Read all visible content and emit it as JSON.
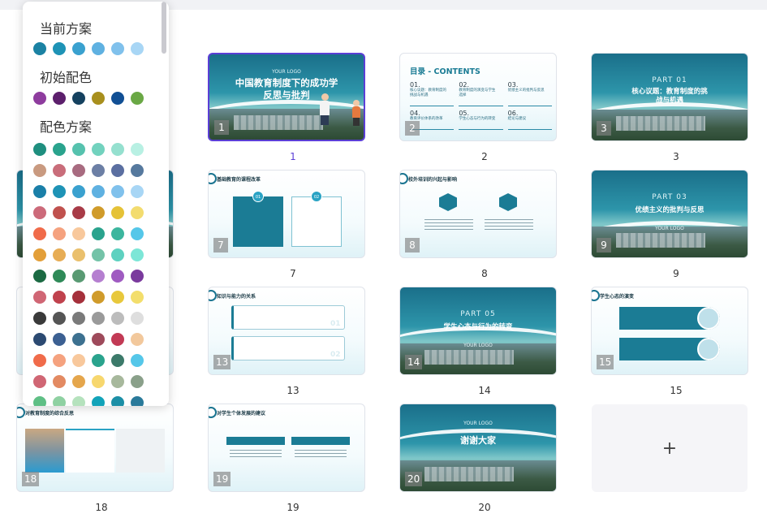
{
  "palette": {
    "current_label": "当前方案",
    "initial_label": "初始配色",
    "schemes_label": "配色方案",
    "current": [
      "#1b82a3",
      "#1e93b6",
      "#3aa1cf",
      "#5fb1e1",
      "#80c1ec",
      "#a8d6f5"
    ],
    "initial": [
      "#8e3c9e",
      "#5c1f6c",
      "#15415f",
      "#a88f1d",
      "#114f94",
      "#6aa845"
    ],
    "schemes": [
      [
        "#1f8f7f",
        "#2aa38d",
        "#56c2ae",
        "#72d2be",
        "#95e0cf",
        "#b8f0e3"
      ],
      [
        "#c99a80",
        "#c96d7a",
        "#a86b80",
        "#6c7fa5",
        "#5b6fa1",
        "#56799e"
      ],
      [
        "#1a7fa8",
        "#1e93b6",
        "#3aa1cf",
        "#5fb1e1",
        "#80c1ec",
        "#a8d6f5"
      ],
      [
        "#cc6a7a",
        "#c0514e",
        "#a83b47",
        "#d09b2a",
        "#e5c237",
        "#f3dc6f"
      ],
      [
        "#f06b4a",
        "#f5a27f",
        "#f8c89c",
        "#2aa38d",
        "#3cb69e",
        "#55c7e9"
      ],
      [
        "#e39f39",
        "#e7ad55",
        "#eac06d",
        "#74c3a8",
        "#5ed1c0",
        "#7de6d7"
      ],
      [
        "#1c6a43",
        "#2f8a58",
        "#599a73",
        "#b57fd0",
        "#9f5bc1",
        "#7a3a9d"
      ],
      [
        "#d06674",
        "#c0424d",
        "#a5303b",
        "#d09b2a",
        "#e8c83c",
        "#f3de6c"
      ],
      [
        "#3a3a3a",
        "#555555",
        "#7a7a7a",
        "#9a9a9a",
        "#bcbcbc",
        "#dedede"
      ],
      [
        "#2c4a72",
        "#3c6092",
        "#3d7190",
        "#9e4a5b",
        "#c23a55",
        "#f2c89c"
      ],
      [
        "#f06b4a",
        "#f5a27f",
        "#f8c89c",
        "#2aa38d",
        "#3c7a6a",
        "#55c7e9"
      ],
      [
        "#d06674",
        "#e38a62",
        "#e5a64c",
        "#f7d76e",
        "#a7b89c",
        "#8aa08a"
      ],
      [
        "#5fbf85",
        "#8fd1a2",
        "#b5e2bd",
        "#12a3b9",
        "#1c8fa6",
        "#2a7a9a"
      ]
    ]
  },
  "slides": [
    {
      "n": "1",
      "logo": "YOUR LOGO",
      "title": "中国教育制度下的成功学\n反思与批判"
    },
    {
      "n": "2",
      "title": "目录 - CONTENTS",
      "items": [
        {
          "no": "01.",
          "text": "核心议题：教育制度的\n挑战与机遇"
        },
        {
          "no": "02.",
          "text": "教育制度的演变与学生\n选择"
        },
        {
          "no": "03.",
          "text": "优绩主义的批判与反思"
        },
        {
          "no": "04.",
          "text": "教育评价体系的改革"
        },
        {
          "no": "05.",
          "text": "学生心态与行为的转变"
        },
        {
          "no": "06.",
          "text": "结论与建议"
        }
      ]
    },
    {
      "n": "3",
      "part": "PART 01",
      "title": "核心议题：教育制度的挑\n战与机遇"
    },
    {
      "n": "7",
      "title": "基础教育的课程改革",
      "b1": "01",
      "b2": "02"
    },
    {
      "n": "8",
      "title": "校外培训的兴起与影响"
    },
    {
      "n": "9",
      "part": "PART 03",
      "title": "优绩主义的批判与反思",
      "logo": "YOUR LOGO"
    },
    {
      "n": "13",
      "title": "知识与能力的关系",
      "b1": "01",
      "b2": "02"
    },
    {
      "n": "14",
      "part": "PART 05",
      "title": "学生心态与行为的转变",
      "logo": "YOUR LOGO"
    },
    {
      "n": "15",
      "title": "学生心态的演变"
    },
    {
      "n": "18",
      "title": "对教育制度的综合反思"
    },
    {
      "n": "19",
      "title": "对学生个体发展的建议"
    },
    {
      "n": "20",
      "logo": "YOUR LOGO",
      "title": "谢谢大家"
    }
  ],
  "add": {
    "label": "+"
  }
}
